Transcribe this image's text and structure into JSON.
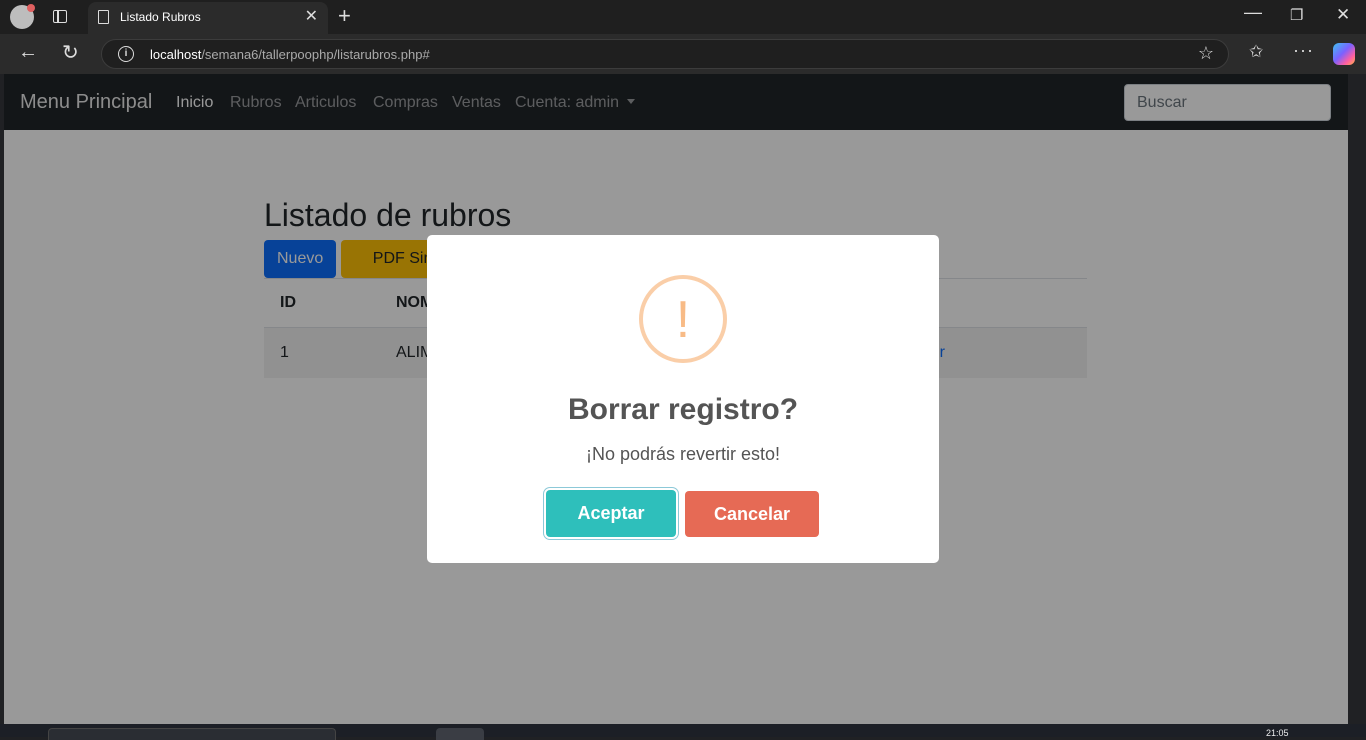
{
  "browser": {
    "tab_title": "Listado Rubros",
    "tab_close": "✕",
    "new_tab": "+",
    "url_host": "localhost",
    "url_path": "/semana6/tallerpoophp/listarubros.php#"
  },
  "navbar": {
    "brand": "Menu Principal",
    "links": [
      "Inicio",
      "Rubros",
      "Articulos",
      "Compras",
      "Ventas",
      "Cuenta: admin"
    ],
    "active": "Inicio",
    "search_placeholder": "Buscar"
  },
  "page": {
    "title": "Listado de rubros",
    "btn_nuevo": "Nuevo",
    "btn_pdf": "PDF Simpl",
    "table": {
      "headers": [
        "ID",
        "NOM"
      ],
      "rows": [
        {
          "id": "1",
          "nombre": "ALIM",
          "action": "r"
        }
      ]
    }
  },
  "modal": {
    "icon": "!",
    "title": "Borrar registro?",
    "text": "¡No podrás revertir esto!",
    "confirm": "Aceptar",
    "cancel": "Cancelar",
    "colors": {
      "confirm": "#2ebfbb",
      "cancel": "#e66a55",
      "warning": "#f8bb86"
    }
  },
  "taskbar": {
    "clock": "21:05"
  }
}
